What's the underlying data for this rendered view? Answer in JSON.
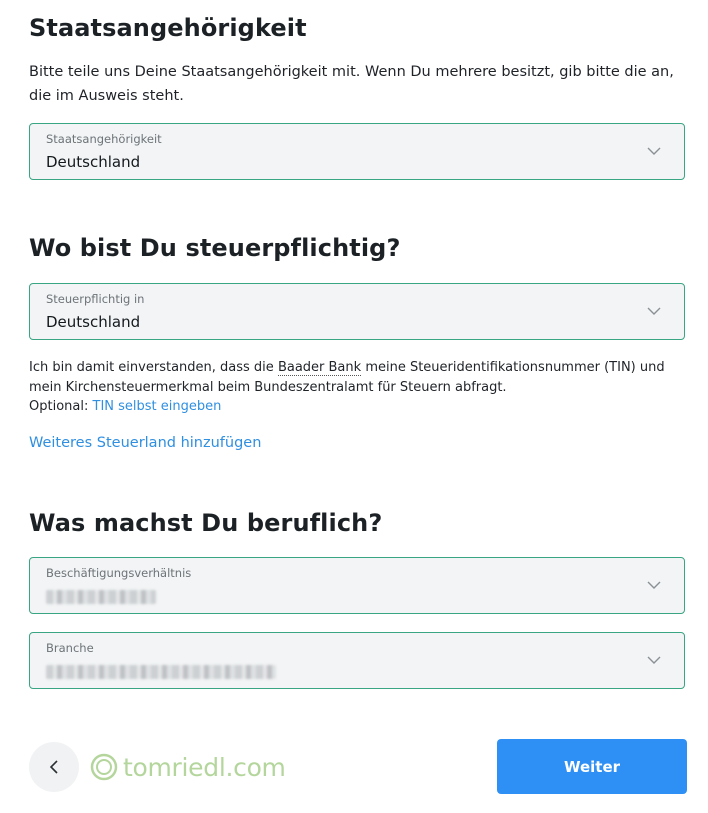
{
  "nationality": {
    "title": "Staatsangehörigkeit",
    "intro": "Bitte teile uns Deine Staatsangehörigkeit mit. Wenn Du mehrere besitzt, gib bitte die an, die im Ausweis steht.",
    "select_label": "Staatsangehörigkeit",
    "select_value": "Deutschland"
  },
  "tax": {
    "title": "Wo bist Du steuerpflichtig?",
    "select_label": "Steuerpflichtig in",
    "select_value": "Deutschland",
    "consent_part1": "Ich bin damit einverstanden, dass die",
    "bank_name": "Baader Bank",
    "consent_part2": "meine Steueridentifikationsnummer (TIN) und mein Kirchensteuermerkmal beim Bundeszentralamt für Steuern abfragt.",
    "optional_label": "Optional:",
    "tin_link": "TIN selbst eingeben",
    "add_country_link": "Weiteres Steuerland hinzufügen"
  },
  "job": {
    "title": "Was machst Du beruflich?",
    "employment_label": "Beschäftigungsverhältnis",
    "industry_label": "Branche"
  },
  "footer": {
    "watermark": "tomriedl.com",
    "next_label": "Weiter"
  },
  "colors": {
    "accent": "#2e90f5",
    "field_border": "#39a583",
    "field_bg": "#f2f4f5",
    "link": "#2f8fe0",
    "watermark": "#a7cf8b"
  },
  "icons": {
    "select_arrow": "chevron-down-icon",
    "back": "chevron-left-icon",
    "watermark_logo": "ring-logo-icon"
  }
}
